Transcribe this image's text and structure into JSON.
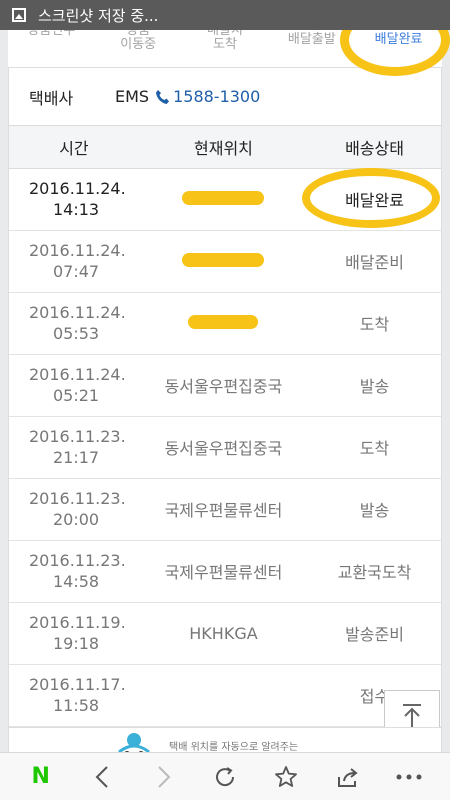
{
  "status_bar": {
    "notification": "스크린샷 저장 중..."
  },
  "steps": [
    {
      "label": "상품인수"
    },
    {
      "label": "상품\n이동중"
    },
    {
      "label": "배달지\n도착"
    },
    {
      "label": "배달출발"
    },
    {
      "label": "배달완료"
    }
  ],
  "courier": {
    "label": "택배사",
    "name": "EMS",
    "phone": "1588-1300"
  },
  "table": {
    "headers": {
      "time": "시간",
      "location": "현재위치",
      "status": "배송상태"
    },
    "rows": [
      {
        "date": "2016.11.24.",
        "clock": "14:13",
        "location": "",
        "status": "배달완료"
      },
      {
        "date": "2016.11.24.",
        "clock": "07:47",
        "location": "",
        "status": "배달준비"
      },
      {
        "date": "2016.11.24.",
        "clock": "05:53",
        "location": "",
        "status": "도착"
      },
      {
        "date": "2016.11.24.",
        "clock": "05:21",
        "location": "동서울우편집중국",
        "status": "발송"
      },
      {
        "date": "2016.11.23.",
        "clock": "21:17",
        "location": "동서울우편집중국",
        "status": "도착"
      },
      {
        "date": "2016.11.23.",
        "clock": "20:00",
        "location": "국제우편물류센터",
        "status": "발송"
      },
      {
        "date": "2016.11.23.",
        "clock": "14:58",
        "location": "국제우편물류센터",
        "status": "교환국도착"
      },
      {
        "date": "2016.11.19.",
        "clock": "19:18",
        "location": "HKHKGA",
        "status": "발송준비"
      },
      {
        "date": "2016.11.17.",
        "clock": "11:58",
        "location": "",
        "status": "접수"
      }
    ]
  },
  "banner": {
    "text": "택배 위치를 자동으로 알려주는"
  },
  "toolbar": {
    "logo": "N"
  },
  "colors": {
    "accent": "#3d7de0",
    "highlight": "#f7c316",
    "phone": "#1f5fa8",
    "naver": "#1ec800"
  }
}
